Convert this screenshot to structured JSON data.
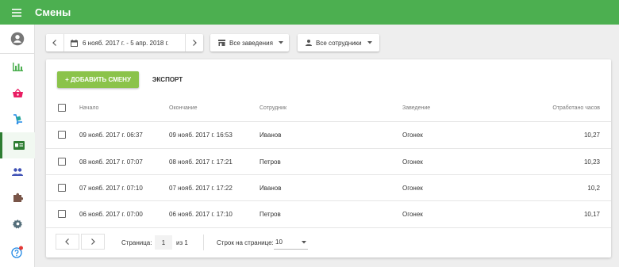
{
  "app": {
    "title": "Смены"
  },
  "icons": {
    "menu": "hamburger-menu-icon",
    "profile": "account-circle-icon",
    "reports": "bar-chart-icon",
    "orders": "basket-icon",
    "delivery": "hand-truck-icon",
    "shifts": "badge-card-icon",
    "employees": "people-icon",
    "plugins": "puzzle-icon",
    "settings": "gear-icon",
    "help": "help-circle-icon"
  },
  "colors": {
    "topbar": "#4caf50",
    "add_button": "#8bc34a",
    "active_nav": "#2e7d32",
    "notification_dot": "#e53935"
  },
  "filters": {
    "date_range": "6 нояб. 2017 г. - 5 апр. 2018 г.",
    "venue": "Все заведения",
    "employee": "Все сотрудники"
  },
  "actions": {
    "add_shift": "+ ДОБАВИТЬ СМЕНУ",
    "export": "ЭКСПОРТ"
  },
  "table": {
    "columns": {
      "start": "Начало",
      "end": "Окончание",
      "employee": "Сотрудник",
      "venue": "Заведение",
      "hours": "Отработано часов"
    },
    "rows": [
      {
        "start": "09 нояб. 2017 г. 06:37",
        "end": "09 нояб. 2017 г. 16:53",
        "employee": "Иванов",
        "venue": "Огонек",
        "hours": "10,27"
      },
      {
        "start": "08 нояб. 2017 г. 07:07",
        "end": "08 нояб. 2017 г. 17:21",
        "employee": "Петров",
        "venue": "Огонек",
        "hours": "10,23"
      },
      {
        "start": "07 нояб. 2017 г. 07:10",
        "end": "07 нояб. 2017 г. 17:22",
        "employee": "Иванов",
        "venue": "Огонек",
        "hours": "10,2"
      },
      {
        "start": "06 нояб. 2017 г. 07:00",
        "end": "06 нояб. 2017 г. 17:10",
        "employee": "Петров",
        "venue": "Огонек",
        "hours": "10,17"
      }
    ]
  },
  "pagination": {
    "page_label": "Страница:",
    "page_value": "1",
    "of_label": "из 1",
    "rows_per_page_label": "Строк на странице:",
    "rows_per_page_value": "10"
  }
}
